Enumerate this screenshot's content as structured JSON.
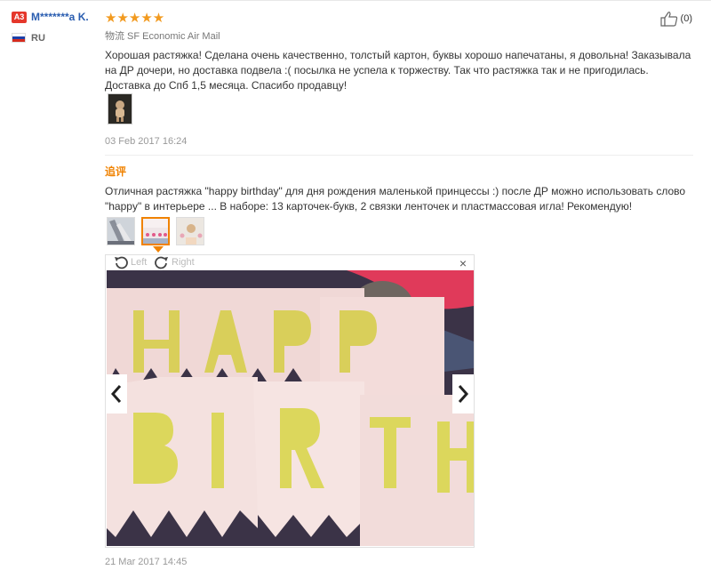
{
  "review": {
    "badge": "A3",
    "username": "M*******a K.",
    "country": "RU",
    "stars": "★★★★★",
    "like_count": "(0)",
    "shipping": "物流 SF Economic Air Mail",
    "text": "Хорошая растяжка! Сделана очень качественно, толстый картон, буквы хорошо напечатаны, я довольна! Заказывала на ДР дочери, но доставка подвела :( посылка не успела к торжеству. Так что растяжка так и не пригодилась. Доставка до Спб 1,5 месяца. Спасибо продавцу!",
    "date": "03 Feb 2017 16:24"
  },
  "followup": {
    "title": "追评",
    "text": "Отличная растяжка \"happy birthday\" для дня рождения маленькой принцессы :) после ДР можно использовать слово \"happy\" в интерьере ... В наборе: 13 карточек-букв, 2 связки ленточек и пластмассовая игла! Рекомендую!",
    "date": "21 Mar 2017 14:45"
  },
  "viewer": {
    "rotate_left": "Left",
    "rotate_right": "Right",
    "close": "×"
  },
  "icons": {
    "like": "thumbs-up-icon",
    "rotate_left": "rotate-left-icon",
    "rotate_right": "rotate-right-icon",
    "prev": "chevron-left-icon",
    "next": "chevron-right-icon",
    "close": "close-icon"
  },
  "colors": {
    "username": "#2a5db0",
    "stars": "#f29a1f",
    "followup": "#f08200",
    "badge": "#e5372b"
  }
}
